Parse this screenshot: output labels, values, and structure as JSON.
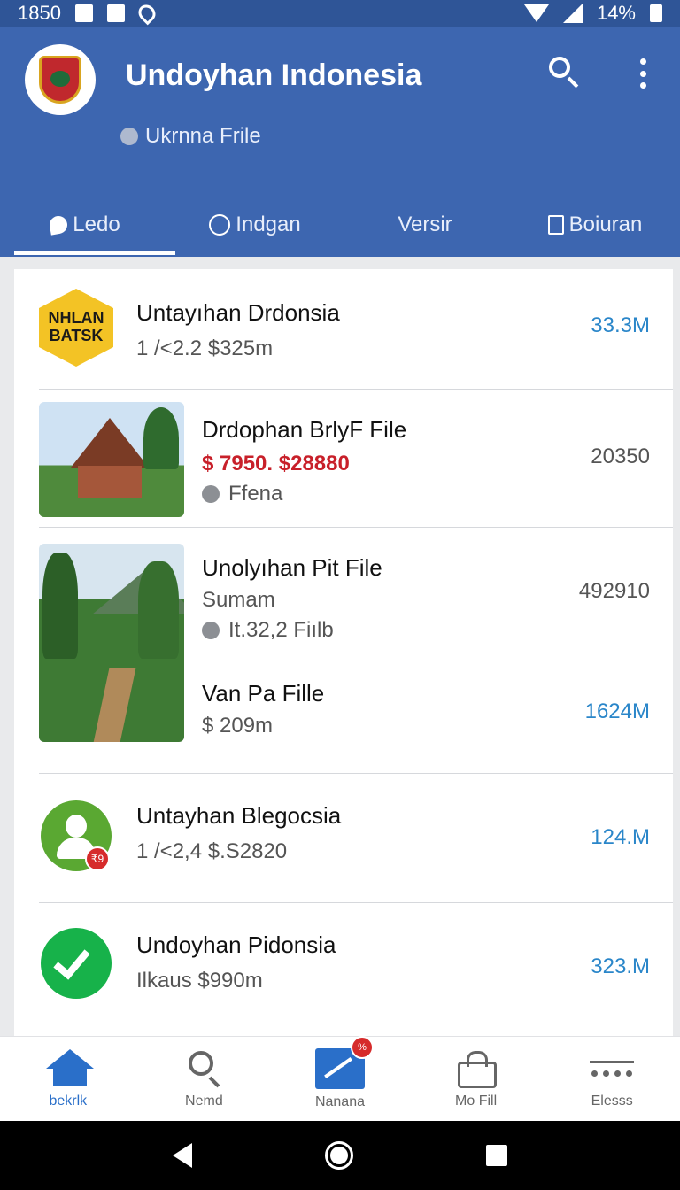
{
  "status_bar": {
    "time": "1850",
    "battery": "14%",
    "icons": [
      "download-icon",
      "square-icon",
      "location-icon",
      "wifi-icon",
      "signal-icon",
      "battery-icon"
    ]
  },
  "header": {
    "title": "Undoyhan Indonesia",
    "subtitle": "Ukrnna Frile",
    "icons": [
      "emblem-logo",
      "search-icon",
      "more-vertical-icon"
    ]
  },
  "tabs": [
    {
      "label": "Ledo",
      "icon": "chat-bubble-icon",
      "active": true
    },
    {
      "label": "Indgan",
      "icon": "circle-icon",
      "active": false
    },
    {
      "label": "Versir",
      "icon": "",
      "active": false
    },
    {
      "label": "Boiuran",
      "icon": "square-outline-icon",
      "active": false
    }
  ],
  "list": [
    {
      "badge_line1": "NHLAN",
      "badge_line2": "BATSK",
      "title": "Untayıhan Drdonsia",
      "subtitle": "1 /<2.2 $325m",
      "value": "33.3M",
      "value_color": "#2a86c9"
    },
    {
      "title": "Drdophan BrlyF File",
      "price": "$ 7950. $28880",
      "meta": "Ffena",
      "value": "20350",
      "value_color": "#555555"
    },
    {
      "title": "Unolyıhan Pit File",
      "subtitle": "Sumam",
      "meta": "It.32,2 Fiılb",
      "value": "492910",
      "value_color": "#555555",
      "second_title": "Van Pa Fille",
      "second_subtitle": "$ 209m",
      "second_value": "1624M",
      "second_value_color": "#2a86c9"
    },
    {
      "title": "Untayhan Blegocsia",
      "subtitle": "1 /<2,4 $.S2820",
      "value": "124.M",
      "value_color": "#2a86c9",
      "alert_badge": "₹9"
    },
    {
      "title": "Undoyhan Pidonsia",
      "subtitle": "Ilkaus $990m",
      "value": "323.M",
      "value_color": "#2a86c9"
    }
  ],
  "bottom_nav": [
    {
      "label": "bekrlk",
      "icon": "home-icon",
      "active": true
    },
    {
      "label": "Nemd",
      "icon": "search-icon",
      "active": false
    },
    {
      "label": "Nanana",
      "icon": "chart-icon",
      "active": false,
      "badge": "%"
    },
    {
      "label": "Mo Fill",
      "icon": "bag-icon",
      "active": false
    },
    {
      "label": "Elesss",
      "icon": "more-dots-icon",
      "active": false
    }
  ],
  "accent_color": "#3d66b0"
}
